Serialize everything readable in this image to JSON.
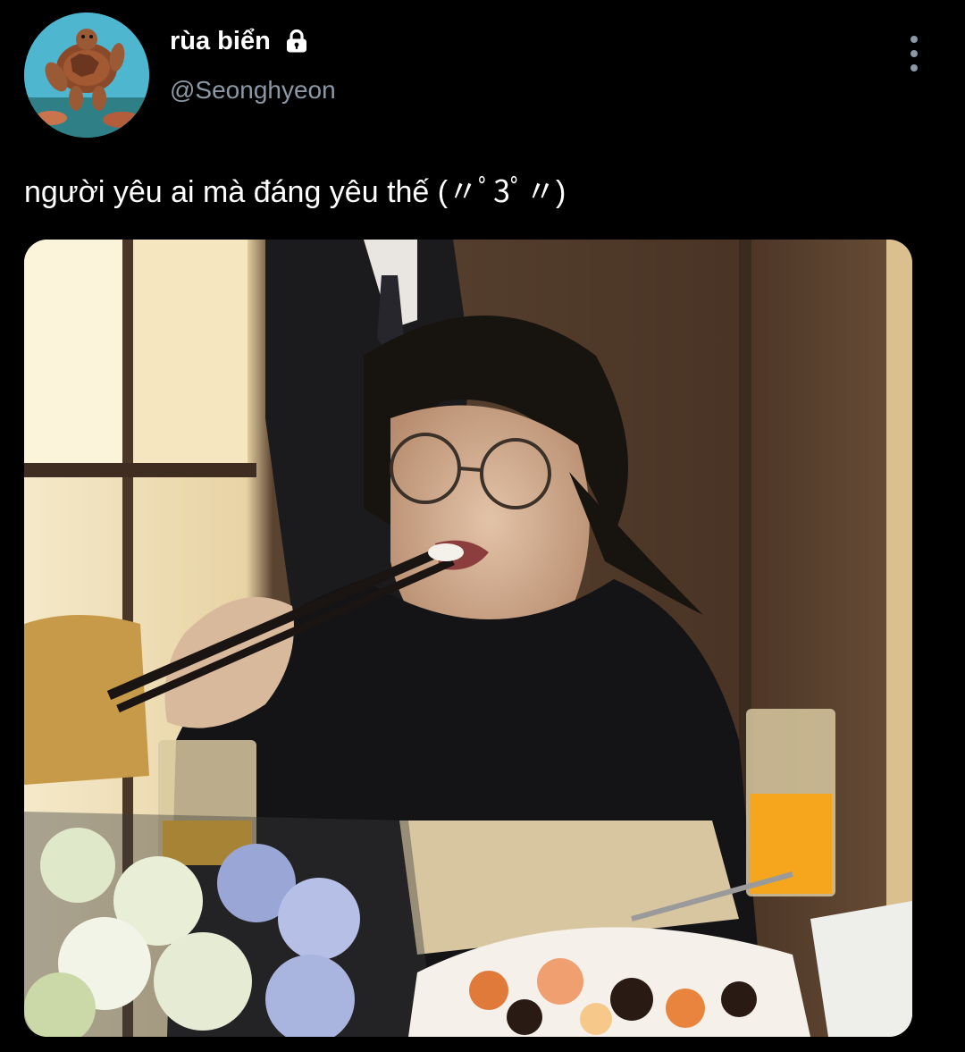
{
  "tweet": {
    "author": {
      "display_name": "rùa biển",
      "handle": "@Seonghyeon",
      "protected_icon": "lock-icon",
      "avatar_icon": "sea-turtle-avatar"
    },
    "text": "người yêu ai mà đáng yêu thế (〃ﾟ3ﾟ〃)",
    "more_icon": "more-vertical-icon",
    "media": {
      "type": "photo",
      "subject": "person-eating-with-chopsticks"
    }
  },
  "colors": {
    "background": "#000000",
    "primary_text": "#ffffff",
    "secondary_text": "#8b98a5"
  }
}
